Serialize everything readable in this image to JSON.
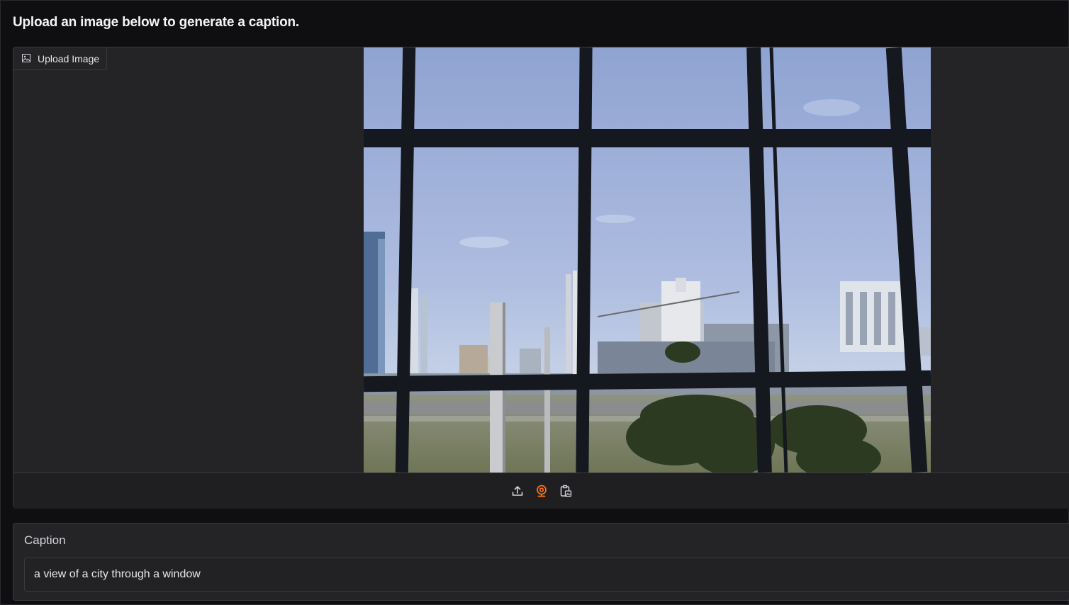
{
  "header": {
    "title": "Upload an image below to generate a caption."
  },
  "image_input": {
    "label": "Upload Image",
    "label_icon": "image-icon",
    "toolbar": [
      {
        "name": "upload-icon",
        "color": "#d1d5db"
      },
      {
        "name": "webcam-icon",
        "color": "#f97316"
      },
      {
        "name": "clipboard-icon",
        "color": "#d1d5db"
      }
    ]
  },
  "caption": {
    "label": "Caption",
    "value": "a view of a city through a window"
  },
  "colors": {
    "accent": "#f97316",
    "panel": "#242426",
    "background": "#0f0f11"
  }
}
